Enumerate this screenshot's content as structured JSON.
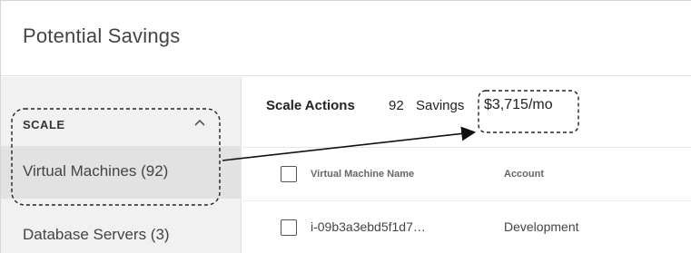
{
  "header": {
    "title": "Potential Savings"
  },
  "sidebar": {
    "group_label": "SCALE",
    "items": [
      {
        "label": "Virtual Machines (92)",
        "active": true
      },
      {
        "label": "Database Servers (3)",
        "active": false
      }
    ]
  },
  "toolbar": {
    "label": "Scale Actions",
    "count": "92",
    "savings_label": "Savings",
    "savings_value": "$3,715/mo"
  },
  "table": {
    "columns": [
      "Virtual Machine Name",
      "Account"
    ],
    "rows": [
      {
        "name": "i-09b3a3ebd5f1d7…",
        "account": "Development"
      }
    ]
  },
  "icons": {
    "chevron": "chevron-up-icon",
    "checkbox": "checkbox-icon"
  }
}
